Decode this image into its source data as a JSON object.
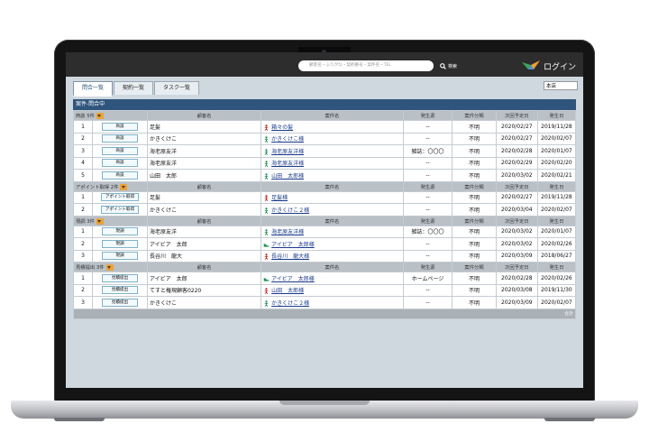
{
  "header": {
    "search_placeholder": "顧客名・ふりがな・契約番号・案件名・TEL",
    "search_label": "検索",
    "login_label": "ログイン"
  },
  "tabs": [
    {
      "label": "問合一覧",
      "active": true
    },
    {
      "label": "契約一覧",
      "active": false
    },
    {
      "label": "タスク一覧",
      "active": false
    }
  ],
  "branch": "本店",
  "panel_title": "案件-問合中",
  "columns": [
    "顧客名",
    "案件名",
    "発生源",
    "案件分類",
    "次回予定日",
    "発生日"
  ],
  "total_label": "合計",
  "groups": [
    {
      "name": "商談 5件",
      "status": "商談",
      "rows": [
        {
          "no": "1",
          "customer": "足髪",
          "icon": "person-red",
          "case": "箱々の髪",
          "source": "--",
          "category": "不明",
          "next": "2020/02/27",
          "date": "2019/11/28"
        },
        {
          "no": "2",
          "customer": "かきくけこ",
          "icon": "person-green",
          "case": "かきくけこ様",
          "source": "--",
          "category": "不明",
          "next": "2020/02/27",
          "date": "2020/02/07"
        },
        {
          "no": "3",
          "customer": "海老原友洋",
          "icon": "person-green",
          "case": "海老原友洋様",
          "source": "雑誌：〇〇〇",
          "category": "不明",
          "next": "2020/02/28",
          "date": "2020/01/07"
        },
        {
          "no": "4",
          "customer": "海老原友洋",
          "icon": "person-green",
          "case": "海老原友洋様",
          "source": "--",
          "category": "不明",
          "next": "2020/02/29",
          "date": "2020/02/20"
        },
        {
          "no": "5",
          "customer": "山田　太郎",
          "icon": "person-green",
          "case": "山田　太郎様",
          "source": "--",
          "category": "不明",
          "next": "2020/03/02",
          "date": "2020/02/21"
        }
      ]
    },
    {
      "name": "アポイント取得 2件",
      "status": "アポイント取得",
      "rows": [
        {
          "no": "1",
          "customer": "足髪",
          "icon": "person-red",
          "case": "足髪様",
          "source": "--",
          "category": "不明",
          "next": "2020/02/27",
          "date": "2019/11/28"
        },
        {
          "no": "2",
          "customer": "かきくけこ",
          "icon": "person-green",
          "case": "かきくけこ２様",
          "source": "--",
          "category": "不明",
          "next": "2020/03/04",
          "date": "2020/02/07"
        }
      ]
    },
    {
      "name": "現調 3件",
      "status": "現調",
      "rows": [
        {
          "no": "1",
          "customer": "海老原友洋",
          "icon": "person-green",
          "case": "海老原友洋様",
          "source": "雑誌：〇〇〇",
          "category": "不明",
          "next": "2020/03/02",
          "date": "2020/01/07"
        },
        {
          "no": "2",
          "customer": "アイビア　太郎",
          "icon": "shoe-green",
          "case": "アイビア　太郎様",
          "source": "--",
          "category": "不明",
          "next": "2020/03/02",
          "date": "2020/02/26"
        },
        {
          "no": "3",
          "customer": "長谷川　龍大",
          "icon": "person-red",
          "case": "長谷川　龍大様",
          "source": "--",
          "category": "不明",
          "next": "2020/03/09",
          "date": "2018/06/27"
        }
      ]
    },
    {
      "name": "見積提出 3件",
      "status": "見積提出",
      "rows": [
        {
          "no": "1",
          "customer": "アイビア　太郎",
          "icon": "shoe-green",
          "case": "アイビア　太郎様",
          "source": "ホームページ",
          "category": "不明",
          "next": "2020/02/28",
          "date": "2020/02/26"
        },
        {
          "no": "2",
          "customer": "てすと権現顧客0220",
          "icon": "person-red",
          "case": "山田　太郎様",
          "source": "--",
          "category": "不明",
          "next": "2020/03/08",
          "date": "2019/11/30"
        },
        {
          "no": "3",
          "customer": "かきくけこ",
          "icon": "person-green",
          "case": "かきくけこ２様",
          "source": "--",
          "category": "不明",
          "next": "2020/03/09",
          "date": "2020/02/07"
        }
      ]
    }
  ],
  "colors": {
    "header": "#2d2d2d",
    "panel": "#2f557d",
    "group": "#b9c0c6",
    "badge": "#e8a33a"
  }
}
